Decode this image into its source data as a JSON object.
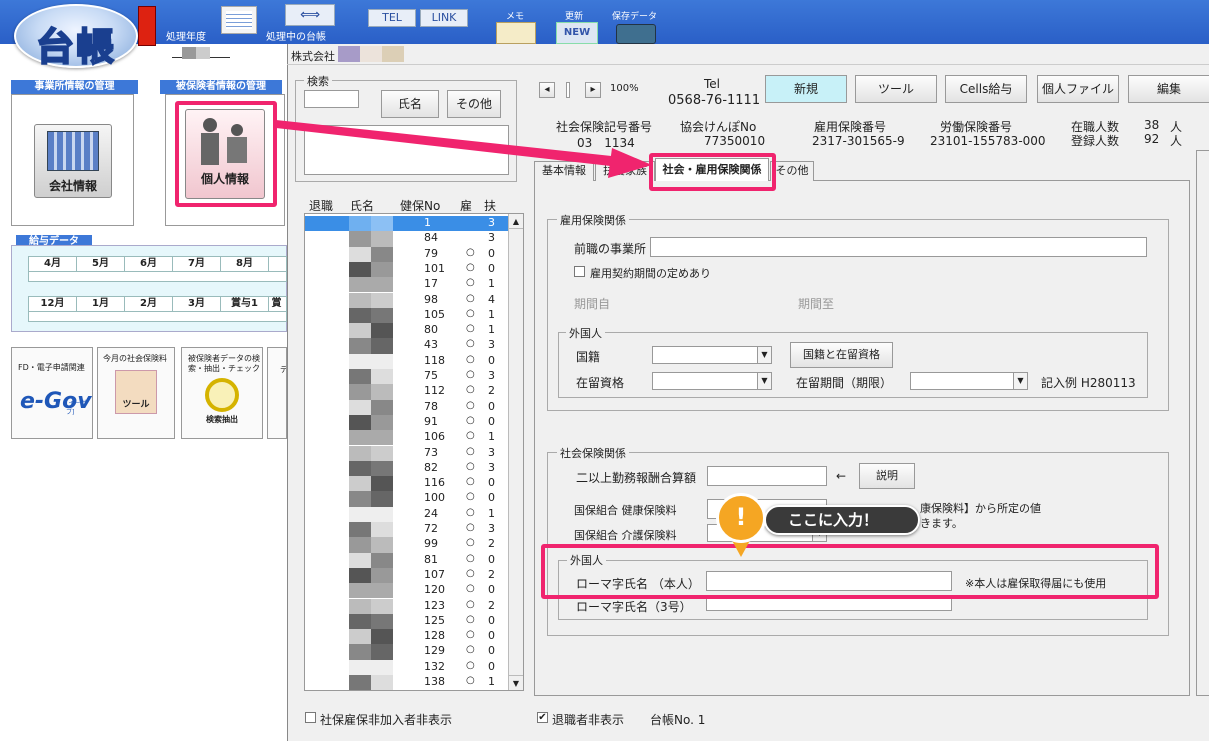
{
  "app": {
    "logo_text": "台帳",
    "toolbar": {
      "year_label": "処理年度",
      "ledger_label": "処理中の台帳",
      "tel_btn": "TEL",
      "link_btn": "LINK",
      "memo_label": "メモ",
      "update_label": "更新",
      "save_label": "保存データ",
      "new_icon_text": "NEW"
    }
  },
  "left": {
    "company_mgmt": "事業所情報の管理",
    "insured_mgmt": "被保険者情報の管理",
    "company_btn": "会社情報",
    "personal_btn": "個人情報",
    "salary_header": "給与データ",
    "months_row1": [
      "4月",
      "5月",
      "6月",
      "7月",
      "8月"
    ],
    "months_row2": [
      "12月",
      "1月",
      "2月",
      "3月",
      "賞与1"
    ],
    "months_row2_extra": "賞",
    "fd_label": "FD・電子申請関連",
    "egov_text": "e-Gov",
    "egov_sub": "[イーガブ]",
    "social_label": "今月の社会保険料",
    "tool_label": "ツール",
    "search_data_label": "被保険者データの検索・抽出・チェック",
    "search_extract_label": "検索抽出",
    "cut_label_1": "デ"
  },
  "window": {
    "company_name": "株式会社",
    "search": {
      "legend": "検索",
      "name_btn": "氏名",
      "other_btn": "その他"
    },
    "list": {
      "headers": [
        "退職",
        "氏名",
        "健保No",
        "雇",
        "扶"
      ],
      "rows": [
        {
          "no": "1",
          "ho": "",
          "fu": "3"
        },
        {
          "no": "84",
          "ho": "",
          "fu": "3"
        },
        {
          "no": "79",
          "ho": "○",
          "fu": "0"
        },
        {
          "no": "101",
          "ho": "○",
          "fu": "0"
        },
        {
          "no": "17",
          "ho": "○",
          "fu": "1"
        },
        {
          "no": "98",
          "ho": "○",
          "fu": "4"
        },
        {
          "no": "105",
          "ho": "○",
          "fu": "1"
        },
        {
          "no": "80",
          "ho": "○",
          "fu": "1"
        },
        {
          "no": "43",
          "ho": "○",
          "fu": "3"
        },
        {
          "no": "118",
          "ho": "○",
          "fu": "0"
        },
        {
          "no": "75",
          "ho": "○",
          "fu": "3"
        },
        {
          "no": "112",
          "ho": "○",
          "fu": "2"
        },
        {
          "no": "78",
          "ho": "○",
          "fu": "0"
        },
        {
          "no": "91",
          "ho": "○",
          "fu": "0"
        },
        {
          "no": "106",
          "ho": "○",
          "fu": "1"
        },
        {
          "no": "73",
          "ho": "○",
          "fu": "3"
        },
        {
          "no": "82",
          "ho": "○",
          "fu": "3"
        },
        {
          "no": "116",
          "ho": "○",
          "fu": "0"
        },
        {
          "no": "100",
          "ho": "○",
          "fu": "0"
        },
        {
          "no": "24",
          "ho": "○",
          "fu": "1"
        },
        {
          "no": "72",
          "ho": "○",
          "fu": "3"
        },
        {
          "no": "99",
          "ho": "○",
          "fu": "2"
        },
        {
          "no": "81",
          "ho": "○",
          "fu": "0"
        },
        {
          "no": "107",
          "ho": "○",
          "fu": "2"
        },
        {
          "no": "120",
          "ho": "○",
          "fu": "0"
        },
        {
          "no": "123",
          "ho": "○",
          "fu": "2"
        },
        {
          "no": "125",
          "ho": "○",
          "fu": "0"
        },
        {
          "no": "128",
          "ho": "○",
          "fu": "0"
        },
        {
          "no": "129",
          "ho": "○",
          "fu": "0"
        },
        {
          "no": "132",
          "ho": "○",
          "fu": "0"
        },
        {
          "no": "138",
          "ho": "○",
          "fu": "1"
        }
      ]
    },
    "nav": {
      "prev": "◂",
      "next": "▸",
      "zoom": "100%"
    },
    "tel_label": "Tel",
    "tel_number": "0568-76-1111",
    "buttons": {
      "new": "新規",
      "tool": "ツール",
      "cells": "Cells給与",
      "personal_file": "個人ファイル",
      "edit": "編集"
    },
    "info": {
      "shaho_label": "社会保険記号番号",
      "shaho_value": "03　1134",
      "kyokai_label": "協会けんぽNo",
      "kyokai_value": "77350010",
      "koyo_label": "雇用保険番号",
      "koyo_value": "2317-301565-9",
      "rodo_label": "労働保険番号",
      "rodo_value": "23101-155783-000",
      "zaishoku_label": "在職人数",
      "zaishoku_value": "38",
      "toroku_label": "登録人数",
      "toroku_value": "92",
      "unit": "人"
    },
    "tabs": [
      "基本情報",
      "扶養家族",
      "社会・雇用保険関係",
      "その他"
    ],
    "employment": {
      "legend": "雇用保険関係",
      "prev_office": "前職の事業所",
      "contract_check": "雇用契約期間の定めあり",
      "period_from": "期間自",
      "period_to": "期間至",
      "foreign_legend": "外国人",
      "nationality": "国籍",
      "nat_btn": "国籍と在留資格",
      "residence_status": "在留資格",
      "residence_period": "在留期間（期限）",
      "example": "記入例  H280113"
    },
    "social": {
      "legend": "社会保険関係",
      "multi_work": "二以上勤務報酬合算額",
      "arrow": "←",
      "explain_btn": "説明",
      "health_label": "国保組合  健康保険料",
      "care_label": "国保組合  介護保険料",
      "note_1": "康保険料】から所定の値",
      "note_2": "きます。",
      "foreign_legend": "外国人",
      "romaji_self": "ローマ字氏名  （本人）",
      "romaji_note": "※本人は雇保取得届にも使用",
      "romaji_3go": "ローマ字氏名（3号）"
    },
    "footer": {
      "hide_nonmember": "社保雇保非加入者非表示",
      "hide_retired": "退職者非表示",
      "ledger_no": "台帳No.  1"
    },
    "callout": {
      "icon": "!",
      "text": "ここに入力！"
    }
  },
  "colors": {
    "highlight": "#f0246e",
    "accent": "#3d78d8",
    "callout": "#f5a623"
  }
}
